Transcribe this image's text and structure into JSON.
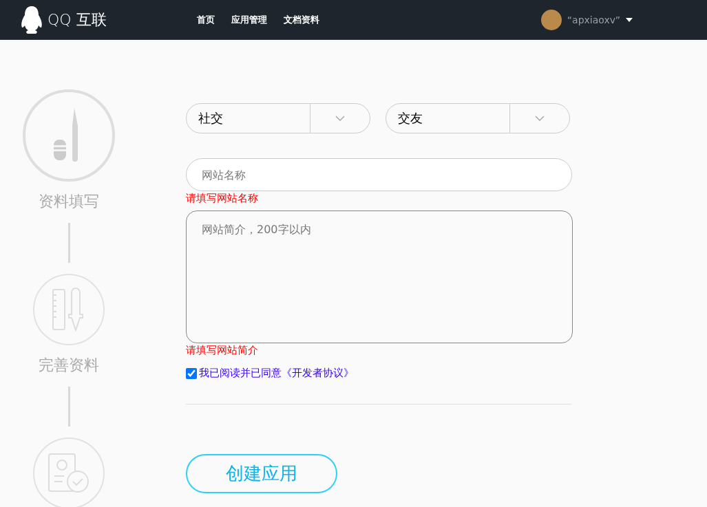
{
  "header": {
    "logo_text": "QQ 互联",
    "nav": [
      {
        "label": "首页"
      },
      {
        "label": "应用管理"
      },
      {
        "label": "文档资料"
      }
    ],
    "user": {
      "name": "“apxiaoxv”"
    }
  },
  "steps": [
    {
      "kind": "edit",
      "label": "资料填写",
      "current": true
    },
    {
      "kind": "design",
      "label": "完善资料",
      "current": false
    },
    {
      "kind": "verify",
      "current": false
    }
  ],
  "form": {
    "category": {
      "value": "社交"
    },
    "subcategory": {
      "value": "交友"
    },
    "site_name": {
      "placeholder": "网站名称",
      "error": "请填写网站名称"
    },
    "site_intro": {
      "placeholder": "网站简介，200字以内",
      "error": "请填写网站简介"
    },
    "agreement": {
      "checked": true,
      "label": "我已阅读并已同意《开发者协议》"
    },
    "submit": "创建应用"
  }
}
